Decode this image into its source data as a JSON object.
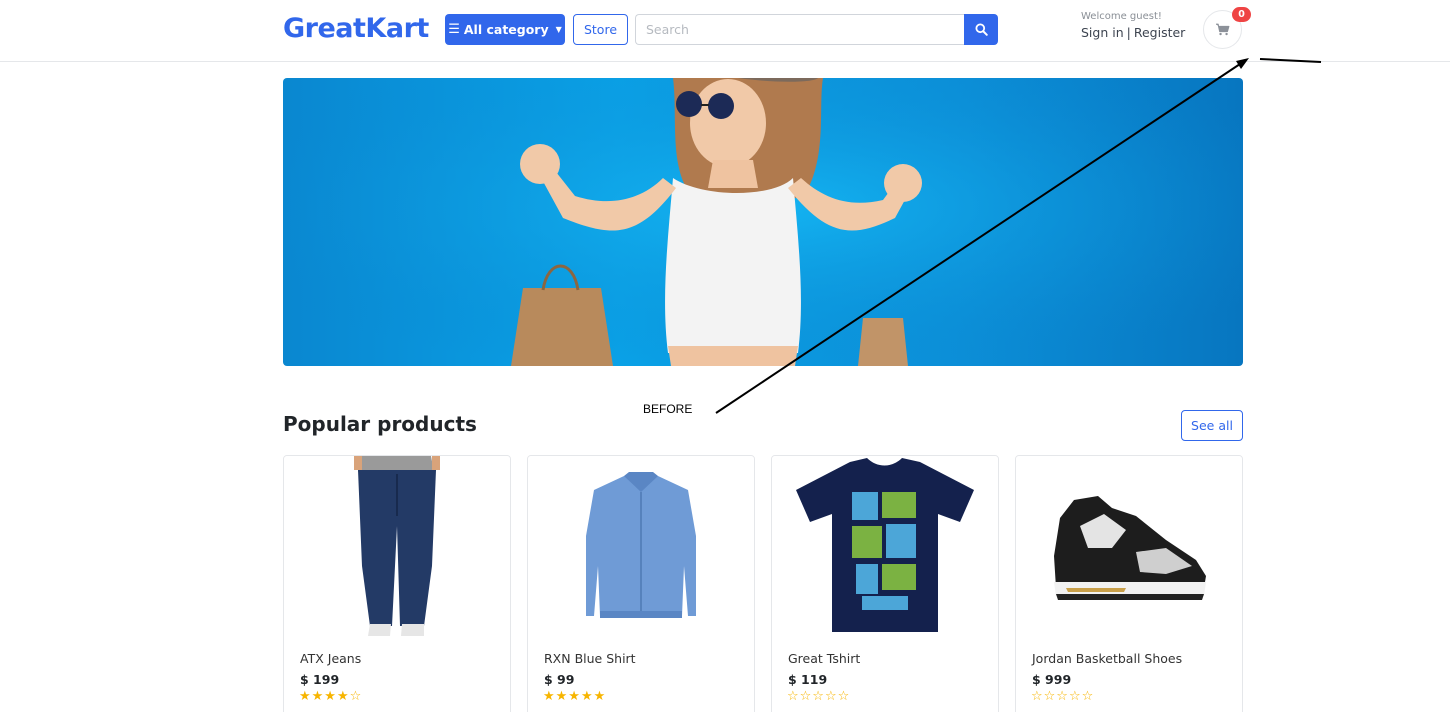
{
  "header": {
    "logo_part1": "Great",
    "logo_part2": "Kart",
    "category_label": "All category",
    "store_label": "Store",
    "search_placeholder": "Search",
    "welcome": "Welcome guest!",
    "sign_in": "Sign in",
    "separator": "|",
    "register": "Register",
    "cart_count": "0"
  },
  "annotation": {
    "label": "BEFORE"
  },
  "section": {
    "title": "Popular products",
    "see_all": "See all"
  },
  "products": [
    {
      "title": "ATX Jeans",
      "price": "$ 199",
      "stars": "★★★★☆",
      "image": "jeans"
    },
    {
      "title": "RXN Blue Shirt",
      "price": "$ 99",
      "stars": "★★★★★",
      "image": "shirt"
    },
    {
      "title": "Great Tshirt",
      "price": "$ 119",
      "stars": "☆☆☆☆☆",
      "image": "tshirt"
    },
    {
      "title": "Jordan Basketball Shoes",
      "price": "$ 999",
      "stars": "☆☆☆☆☆",
      "image": "shoes"
    }
  ],
  "colors": {
    "primary": "#3167eb",
    "badge": "#ef4444",
    "star": "#f7b500",
    "banner": "#0aa3e8"
  }
}
